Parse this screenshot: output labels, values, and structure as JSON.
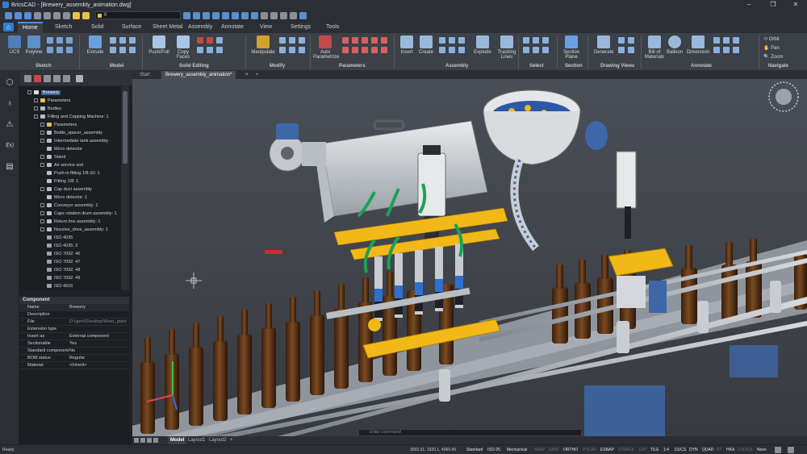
{
  "window": {
    "title": "BricsCAD - [Brewery_assembly_animation.dwg]",
    "minimize": "–",
    "maximize": "❐",
    "close": "✕"
  },
  "quick_access": {
    "layer_value": "0"
  },
  "ribbon_tabs": [
    "Home",
    "Sketch",
    "Solid",
    "Surface",
    "Sheet Metal",
    "Assembly",
    "Annotate",
    "View",
    "Settings",
    "Tools"
  ],
  "active_tab": "Home",
  "ribbon": {
    "buttons": [
      "UCS",
      "Polyline",
      "Extrude",
      "Push/Pull",
      "Copy Faces",
      "Manipulate",
      "Auto Parametrize",
      "Insert",
      "Create",
      "Explode",
      "Tracking Lines",
      "Section Plane",
      "Generate",
      "Bill of Materials",
      "Balloon",
      "Dimension"
    ],
    "navigate": [
      "Orbit",
      "Pan",
      "Zoom"
    ],
    "groups": [
      "Sketch",
      "Model",
      "Solid Editing",
      "Modify",
      "Parameters",
      "Assembly",
      "Select",
      "Section",
      "Drawing Views",
      "Annotate",
      "Navigate"
    ]
  },
  "doc_tabs": [
    "Start",
    "Brewery_assembly_animation*",
    "+"
  ],
  "structure_tree": [
    {
      "label": "Brewery",
      "level": 0,
      "selected": true
    },
    {
      "label": "Parameters",
      "level": 1
    },
    {
      "label": "Bodies",
      "level": 1
    },
    {
      "label": "Filling and Capping Machine: 1",
      "level": 1
    },
    {
      "label": "Parameters",
      "level": 2
    },
    {
      "label": "Bottle_spacer_assembly",
      "level": 2
    },
    {
      "label": "Intermediate tank assembly",
      "level": 2
    },
    {
      "label": "Micro detector",
      "level": 2
    },
    {
      "label": "Stand",
      "level": 2
    },
    {
      "label": "Air service unit",
      "level": 2
    },
    {
      "label": "Push-in fitting 1/8-10: 1",
      "level": 2
    },
    {
      "label": "Fitting 1/8: 1",
      "level": 2
    },
    {
      "label": "Cap duct assembly",
      "level": 2
    },
    {
      "label": "Micro detector: 1",
      "level": 2
    },
    {
      "label": "Conveyor assembly: 1",
      "level": 2
    },
    {
      "label": "Caps rotation drum assembly: 1",
      "level": 2
    },
    {
      "label": "Return line assembly: 1",
      "level": 2
    },
    {
      "label": "Nozzles_drive_assembly: 1",
      "level": 2
    },
    {
      "label": "ISO 4035",
      "level": 3
    },
    {
      "label": "ISO 4035: 2",
      "level": 3
    },
    {
      "label": "ISO 7092: 46",
      "level": 3
    },
    {
      "label": "ISO 7092: 47",
      "level": 3
    },
    {
      "label": "ISO 7092: 48",
      "level": 3
    },
    {
      "label": "ISO 7092: 49",
      "level": 3
    },
    {
      "label": "ISO 4016",
      "level": 3
    }
  ],
  "properties": {
    "heading": "Component",
    "rows": [
      {
        "key": "Name",
        "value": "Brewery"
      },
      {
        "key": "Description",
        "value": ""
      },
      {
        "key": "File",
        "value": "D:\\\\gen\\\\Desktop\\\\Beer_plant",
        "dim": true
      },
      {
        "key": "Extension type",
        "value": ""
      },
      {
        "key": "Insert as",
        "value": "External component"
      },
      {
        "key": "Sectionable",
        "value": "Yes"
      },
      {
        "key": "Standard component",
        "value": "No"
      },
      {
        "key": "BOM status",
        "value": "Regular"
      },
      {
        "key": "Material",
        "value": "<Inherit>"
      }
    ]
  },
  "layout_tabs": [
    "Model",
    "Layout1",
    "Layout2",
    "+"
  ],
  "command_placeholder": ": Enter command",
  "status": {
    "ready": "Ready",
    "coords": "3065.31, 1920.1, 4060.45",
    "items": [
      "Standard",
      "ISO-25",
      "Mechanical",
      "SNAP",
      "GRID",
      "ORTHO",
      "POLAR",
      "ESNAP",
      "STRACK",
      "LWT",
      "TILE",
      "1:4",
      "DUCS",
      "DYN",
      "QUAD",
      "RT",
      "HKA",
      "LOCKUI",
      "None"
    ]
  },
  "colors": {
    "accent": "#4a90e2",
    "viewport_bg": "#3f434a",
    "panel_bg": "#1c1e22",
    "machine_yellow": "#f2b818",
    "bottle_brown": "#5a3216"
  },
  "viewcube": "compass"
}
